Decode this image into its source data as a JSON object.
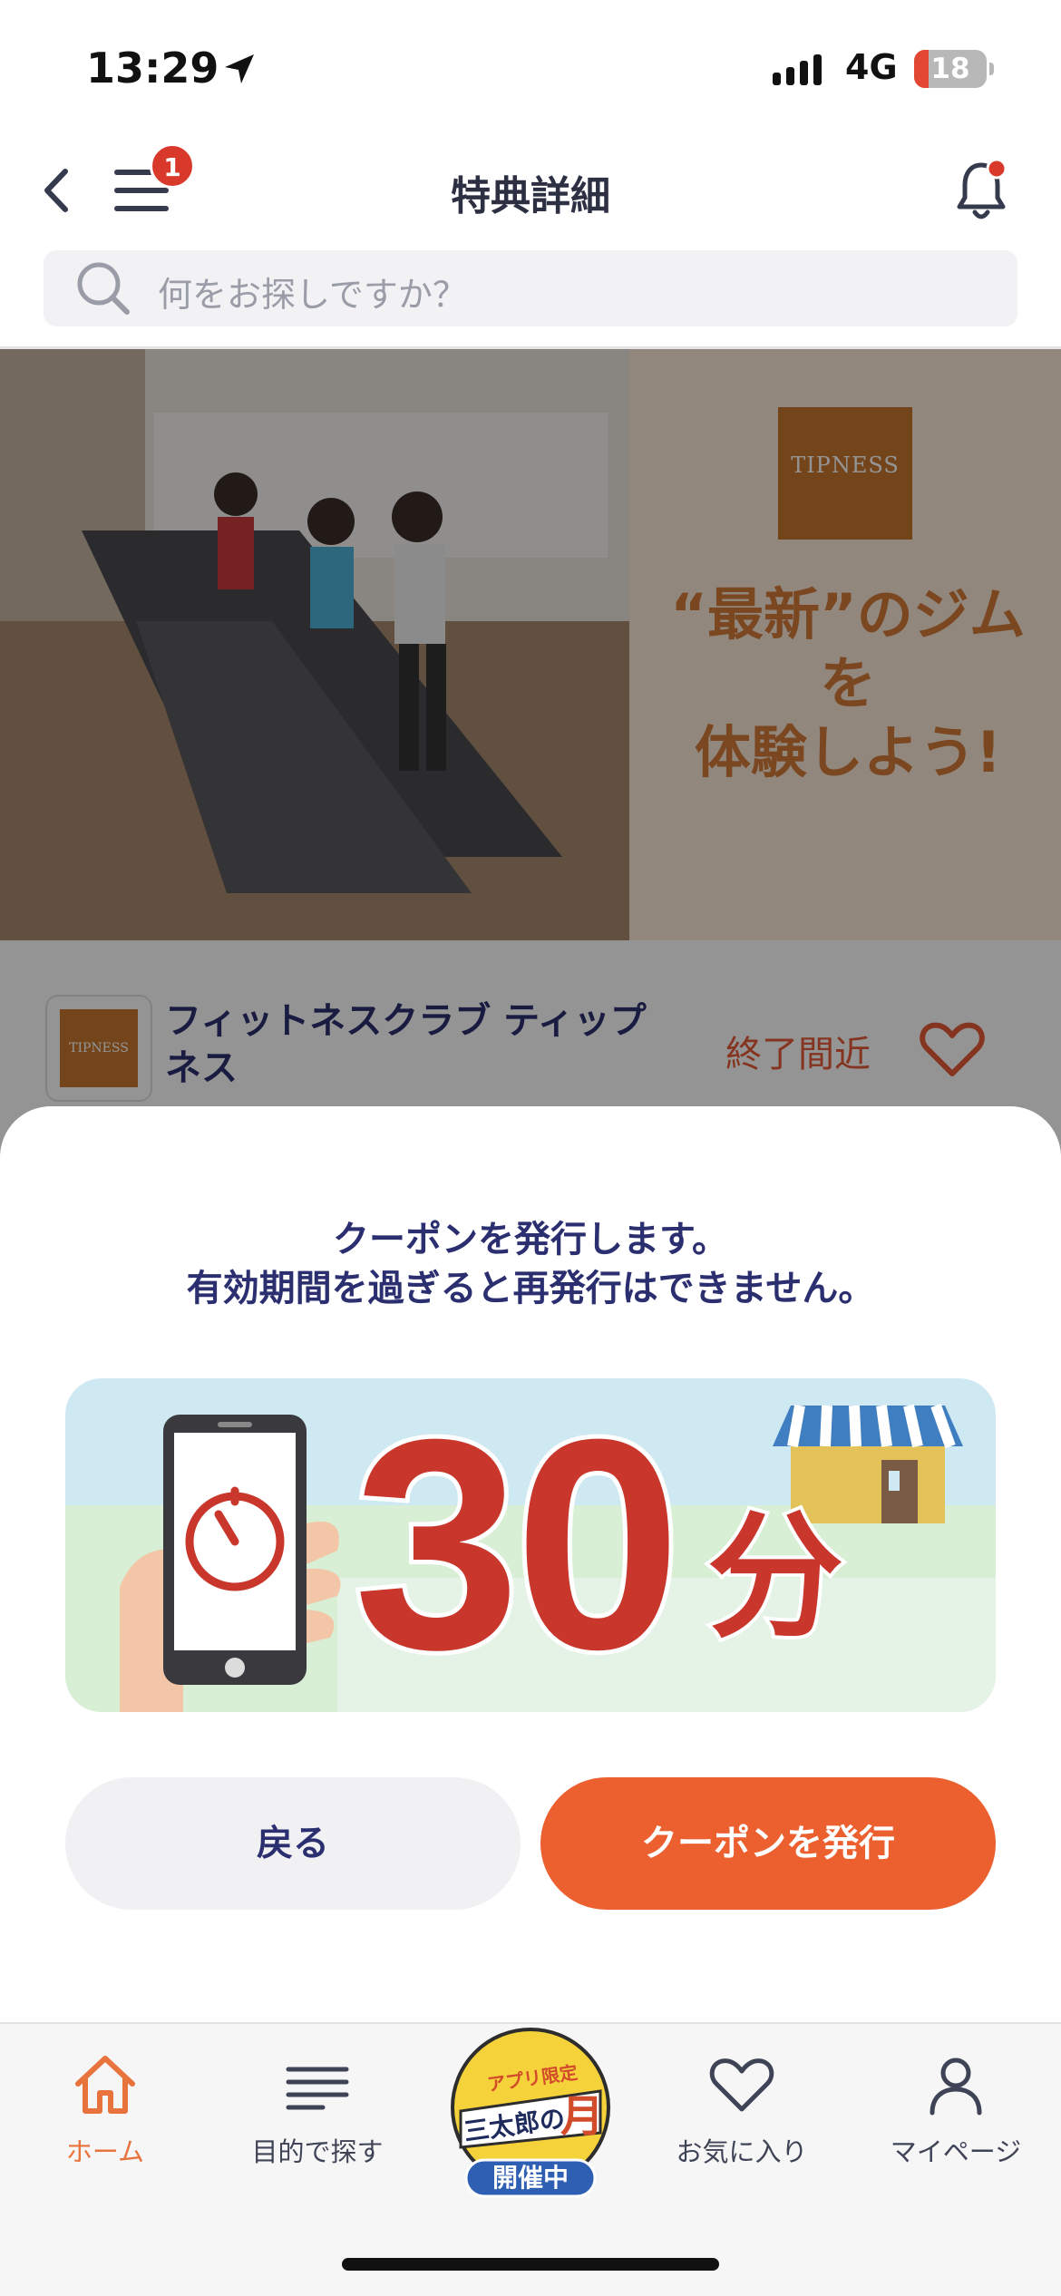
{
  "status_bar": {
    "time": "13:29",
    "network": "4G",
    "battery": "18",
    "battery_level": 18,
    "icons": [
      "location-arrow-icon",
      "signal-icon",
      "battery-icon"
    ]
  },
  "header": {
    "title": "特典詳細",
    "menu_badge": "1",
    "icons": [
      "back-chevron-icon",
      "hamburger-menu-icon",
      "bell-icon"
    ],
    "bell_dot_color": "#d9392b"
  },
  "search": {
    "placeholder": "何をお探しですか？"
  },
  "hero": {
    "logo_text": "TIPNESS",
    "headline_line1": "“最新”のジムを",
    "headline_line2": "体験しよう!"
  },
  "store": {
    "logo_text": "TIPNESS",
    "name": "フィットネスクラブ ティップネス",
    "status": "終了間近",
    "favorite_icon": "heart-outline-icon"
  },
  "modal": {
    "message_line1": "クーポンを発行します。",
    "message_line2": "有効期間を過ぎると再発行はできません。",
    "promo_number": "30",
    "promo_unit": "分",
    "back_label": "戻る",
    "issue_label": "クーポンを発行"
  },
  "tabbar": {
    "tabs": [
      {
        "label": "ホーム",
        "icon": "home-icon",
        "active": true
      },
      {
        "label": "目的で探す",
        "icon": "list-icon",
        "active": false
      },
      {
        "label": "",
        "icon": "campaign-badge",
        "active": false
      },
      {
        "label": "お気に入り",
        "icon": "heart-icon",
        "active": false
      },
      {
        "label": "マイページ",
        "icon": "person-icon",
        "active": false
      }
    ],
    "campaign_line1": "アプリ限定",
    "campaign_line2": "三太郎の",
    "campaign_moon": "月",
    "campaign_line3": "開催中"
  },
  "colors": {
    "accent": "#ec5f2e",
    "navy_text": "#2b2f70",
    "promo_red": "#c8362c",
    "active_tab": "#e9733d"
  }
}
